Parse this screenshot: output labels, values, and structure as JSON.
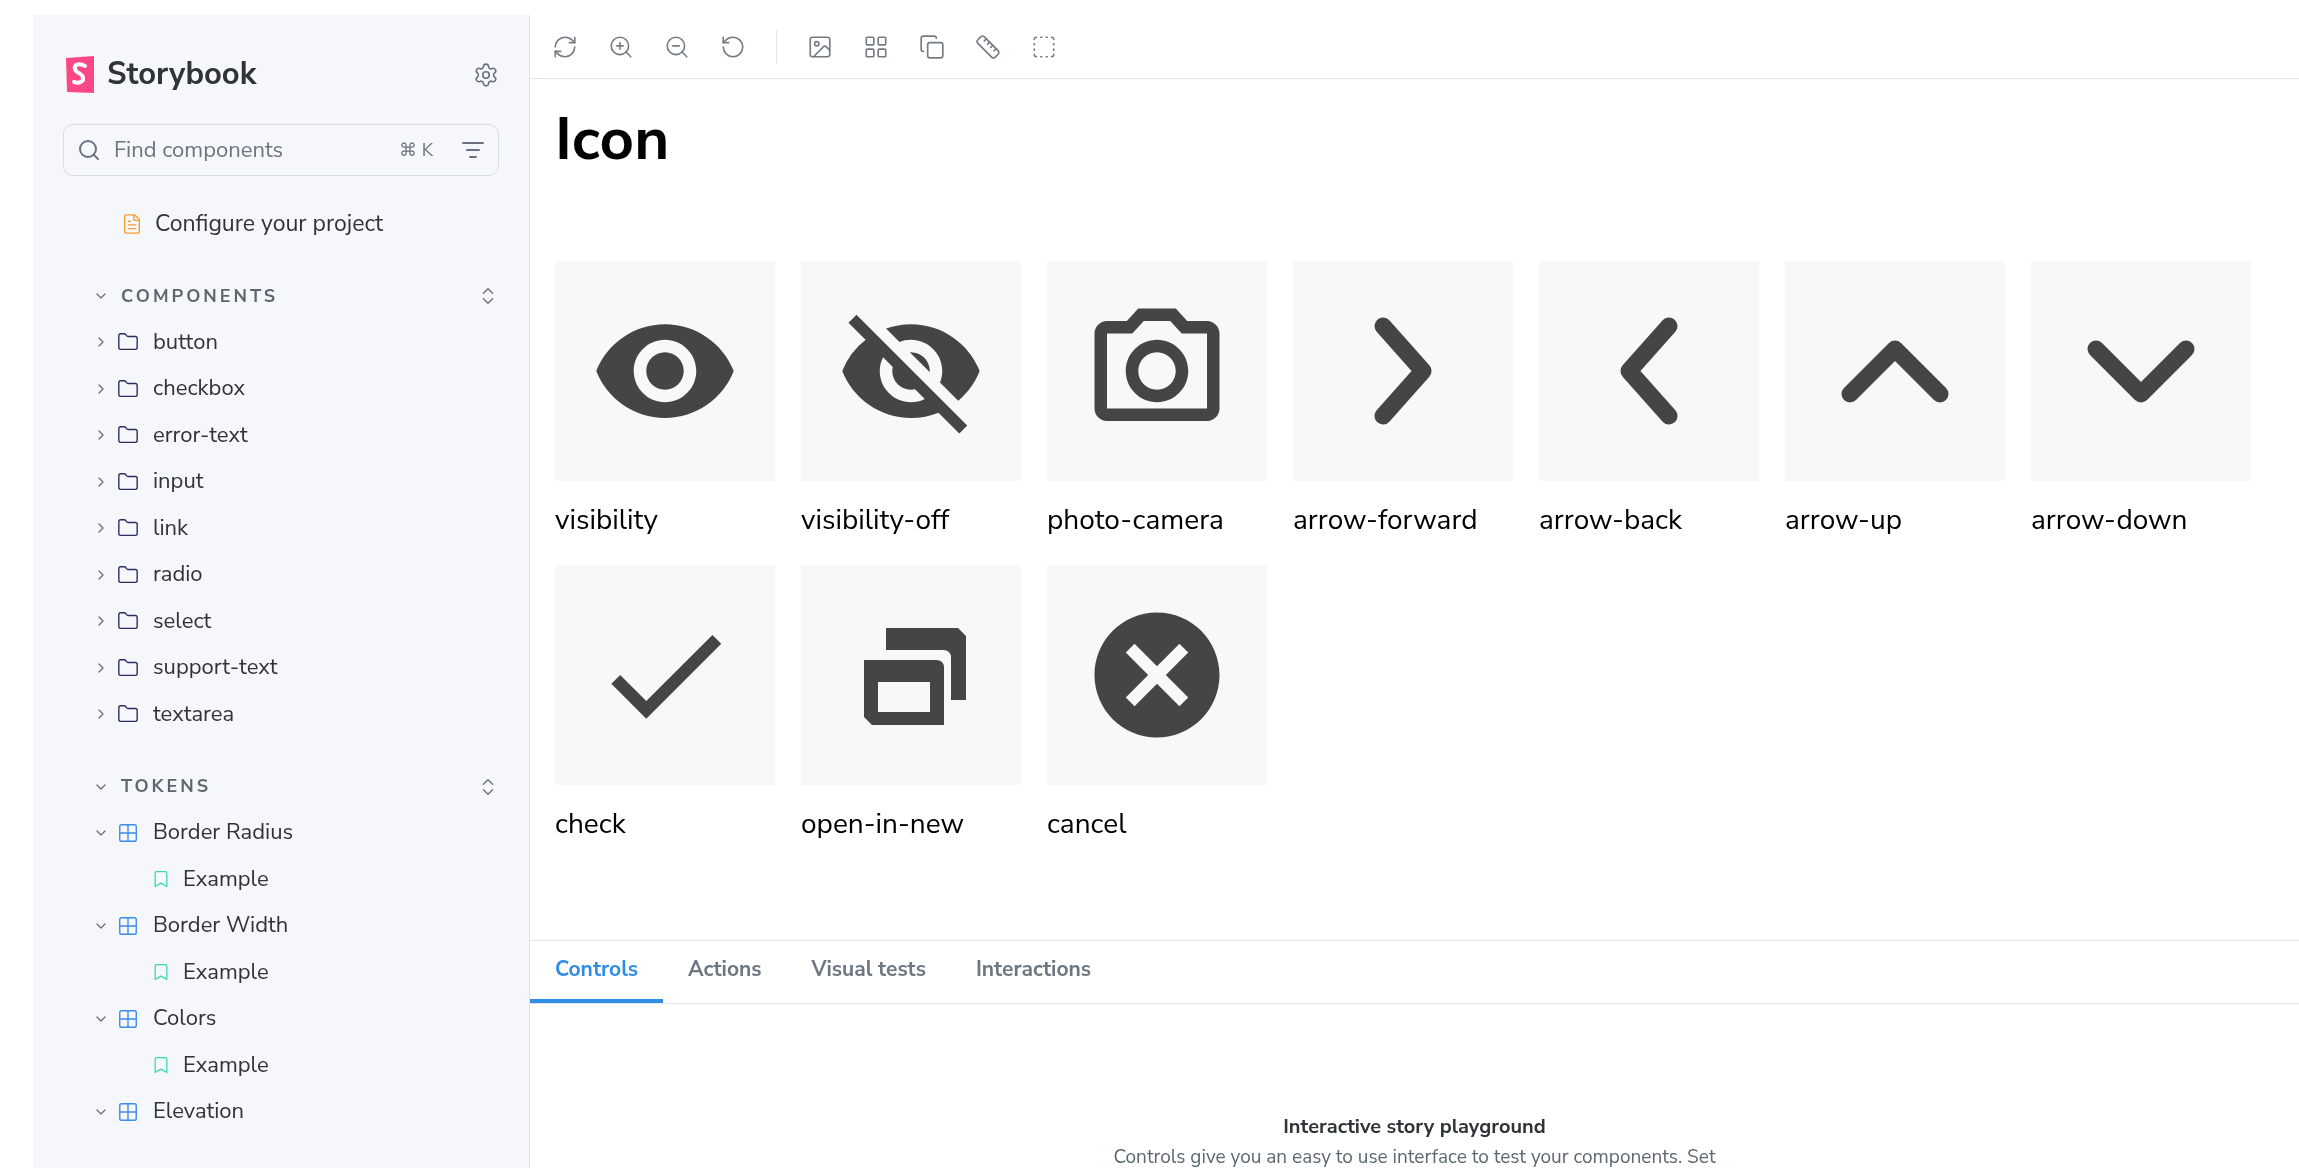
{
  "sidebar": {
    "brand": "Storybook",
    "search": {
      "placeholder": "Find components",
      "shortcut": "⌘ K"
    },
    "top_item": {
      "label": "Configure your project"
    },
    "sections": [
      {
        "title": "COMPONENTS",
        "expanded": true,
        "items": [
          {
            "label": "button",
            "kind": "folder",
            "expanded": false
          },
          {
            "label": "checkbox",
            "kind": "folder",
            "expanded": false
          },
          {
            "label": "error-text",
            "kind": "folder",
            "expanded": false
          },
          {
            "label": "input",
            "kind": "folder",
            "expanded": false
          },
          {
            "label": "link",
            "kind": "folder",
            "expanded": false
          },
          {
            "label": "radio",
            "kind": "folder",
            "expanded": false
          },
          {
            "label": "select",
            "kind": "folder",
            "expanded": false
          },
          {
            "label": "support-text",
            "kind": "folder",
            "expanded": false
          },
          {
            "label": "textarea",
            "kind": "folder",
            "expanded": false
          }
        ]
      },
      {
        "title": "TOKENS",
        "expanded": true,
        "items": [
          {
            "label": "Border Radius",
            "kind": "component",
            "expanded": true,
            "children": [
              {
                "label": "Example",
                "kind": "story"
              }
            ]
          },
          {
            "label": "Border Width",
            "kind": "component",
            "expanded": true,
            "children": [
              {
                "label": "Example",
                "kind": "story"
              }
            ]
          },
          {
            "label": "Colors",
            "kind": "component",
            "expanded": true,
            "children": [
              {
                "label": "Example",
                "kind": "story"
              }
            ]
          },
          {
            "label": "Elevation",
            "kind": "component",
            "expanded": true
          }
        ]
      }
    ]
  },
  "preview": {
    "title": "Icon",
    "icons": [
      {
        "label": "visibility",
        "kind": "visibility"
      },
      {
        "label": "visibility-off",
        "kind": "visibility-off"
      },
      {
        "label": "photo-camera",
        "kind": "camera"
      },
      {
        "label": "arrow-forward",
        "kind": "forward"
      },
      {
        "label": "arrow-back",
        "kind": "back"
      },
      {
        "label": "arrow-up",
        "kind": "up"
      },
      {
        "label": "arrow-down",
        "kind": "down"
      },
      {
        "label": "check",
        "kind": "check"
      },
      {
        "label": "open-in-new",
        "kind": "windows"
      },
      {
        "label": "cancel",
        "kind": "cancel"
      }
    ]
  },
  "addons": {
    "tabs": [
      {
        "label": "Controls",
        "selected": true
      },
      {
        "label": "Actions",
        "selected": false
      },
      {
        "label": "Visual tests",
        "selected": false
      },
      {
        "label": "Interactions",
        "selected": false
      }
    ],
    "heading": "Interactive story playground",
    "text": "Controls give you an easy to use interface to test your components. Set"
  }
}
